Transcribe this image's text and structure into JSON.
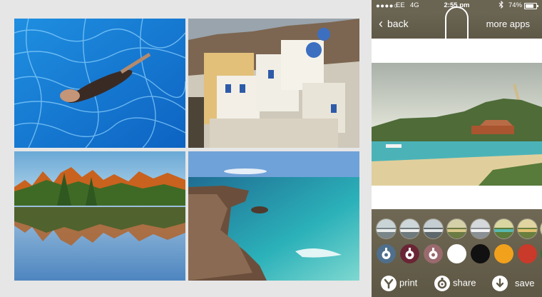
{
  "statusbar": {
    "signal": "●●●●○",
    "carrier": "EE",
    "network": "4G",
    "time": "2:55 pm",
    "battery": "74%"
  },
  "navbar": {
    "back_label": "back",
    "more_label": "more apps"
  },
  "collage": {
    "tiles": [
      "pool-photo",
      "santorini-photo",
      "lake-reflection-photo",
      "rocky-coast-photo"
    ]
  },
  "filters": {
    "row1_count": 7,
    "selected_index": 3,
    "swatch_colors": [
      "#ffffff",
      "#111111",
      "#f2a11d",
      "#c93a2a"
    ]
  },
  "actions": {
    "print_label": "print",
    "share_label": "share",
    "save_label": "save"
  },
  "colors": {
    "bar": "#6a6452",
    "panel": "#645e4c"
  }
}
